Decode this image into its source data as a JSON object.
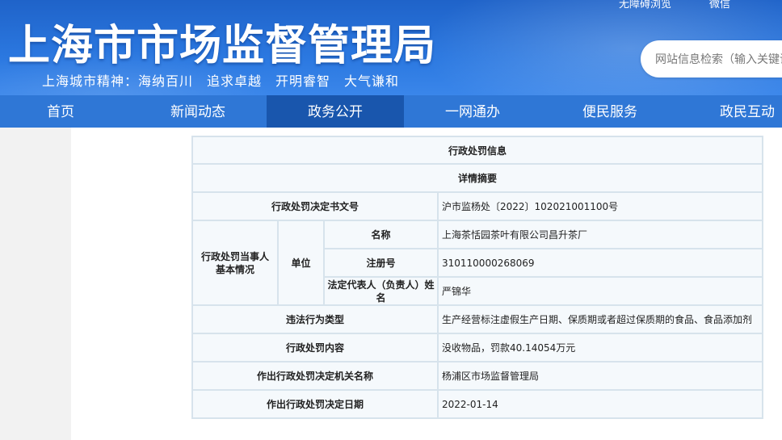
{
  "header": {
    "site_title": "上海市市场监督管理局",
    "city_spirit": "上海城市精神：海纳百川　追求卓越　开明睿智　大气谦和",
    "top_links": [
      "无障碍浏览",
      "微信"
    ],
    "search_placeholder": "网站信息检索（输入关键词）"
  },
  "nav": {
    "items": [
      "首页",
      "新闻动态",
      "政务公开",
      "一网通办",
      "便民服务",
      "政民互动"
    ],
    "active": "政务公开"
  },
  "detail": {
    "title": "行政处罚信息",
    "subtitle": "详情摘要",
    "rows": {
      "decision_no_label": "行政处罚决定书文号",
      "decision_no": "沪市监杨处〔2022〕102021001100号",
      "party_label": "行政处罚当事人基本情况",
      "unit_label": "单位",
      "name_label": "名称",
      "name": "上海茶恬园茶叶有限公司昌升茶厂",
      "reg_label": "注册号",
      "reg": "310110000268069",
      "legal_rep_label": "法定代表人（负责人）姓名",
      "legal_rep": "严锦华",
      "violation_type_label": "违法行为类型",
      "violation_type": "生产经营标注虚假生产日期、保质期或者超过保质期的食品、食品添加剂",
      "penalty_content_label": "行政处罚内容",
      "penalty_content": "没收物品，罚款40.14054万元",
      "authority_label": "作出行政处罚决定机关名称",
      "authority": "杨浦区市场监督管理局",
      "date_label": "作出行政处罚决定日期",
      "date": "2022-01-14"
    }
  },
  "colors": {
    "header_blue": "#2b78e0",
    "nav_blue": "#2f77d6",
    "nav_active": "#1956ad",
    "table_border": "#d7e3ec",
    "table_bg": "#f5f9fc"
  }
}
